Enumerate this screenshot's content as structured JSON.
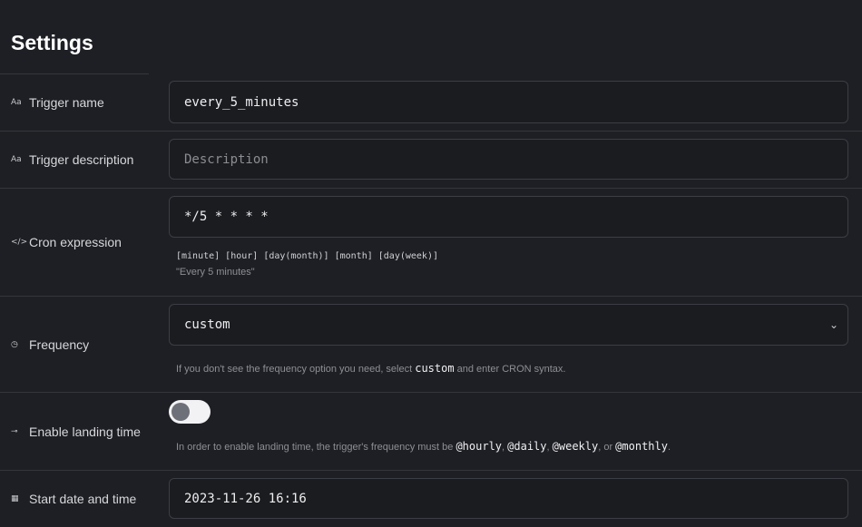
{
  "page": {
    "title": "Settings"
  },
  "rows": {
    "trigger_name": {
      "label": "Trigger name",
      "icon": "Aa",
      "value": "every_5_minutes"
    },
    "trigger_description": {
      "label": "Trigger description",
      "icon": "Aa",
      "placeholder": "Description",
      "value": ""
    },
    "cron_expression": {
      "label": "Cron expression",
      "icon": "</>",
      "value": "*/5 * * * *",
      "syntax_hint": "[minute] [hour] [day(month)] [month] [day(week)]",
      "description": "\"Every 5 minutes\""
    },
    "frequency": {
      "label": "Frequency",
      "icon": "◷",
      "selected": "custom",
      "chevron": "⌄",
      "hint_pre": "If you don't see the frequency option you need, select ",
      "hint_code": "custom",
      "hint_post": " and enter CRON syntax."
    },
    "landing_time": {
      "label": "Enable landing time",
      "icon": "⊸",
      "enabled": false,
      "hint_pre": "In order to enable landing time, the trigger's frequency must be ",
      "code_hourly": "@hourly",
      "sep1": ", ",
      "code_daily": "@daily",
      "sep2": ", ",
      "code_weekly": "@weekly",
      "sep3": ", or ",
      "code_monthly": "@monthly",
      "hint_end": "."
    },
    "start_date": {
      "label": "Start date and time",
      "icon": "▦",
      "value": "2023-11-26 16:16"
    }
  }
}
